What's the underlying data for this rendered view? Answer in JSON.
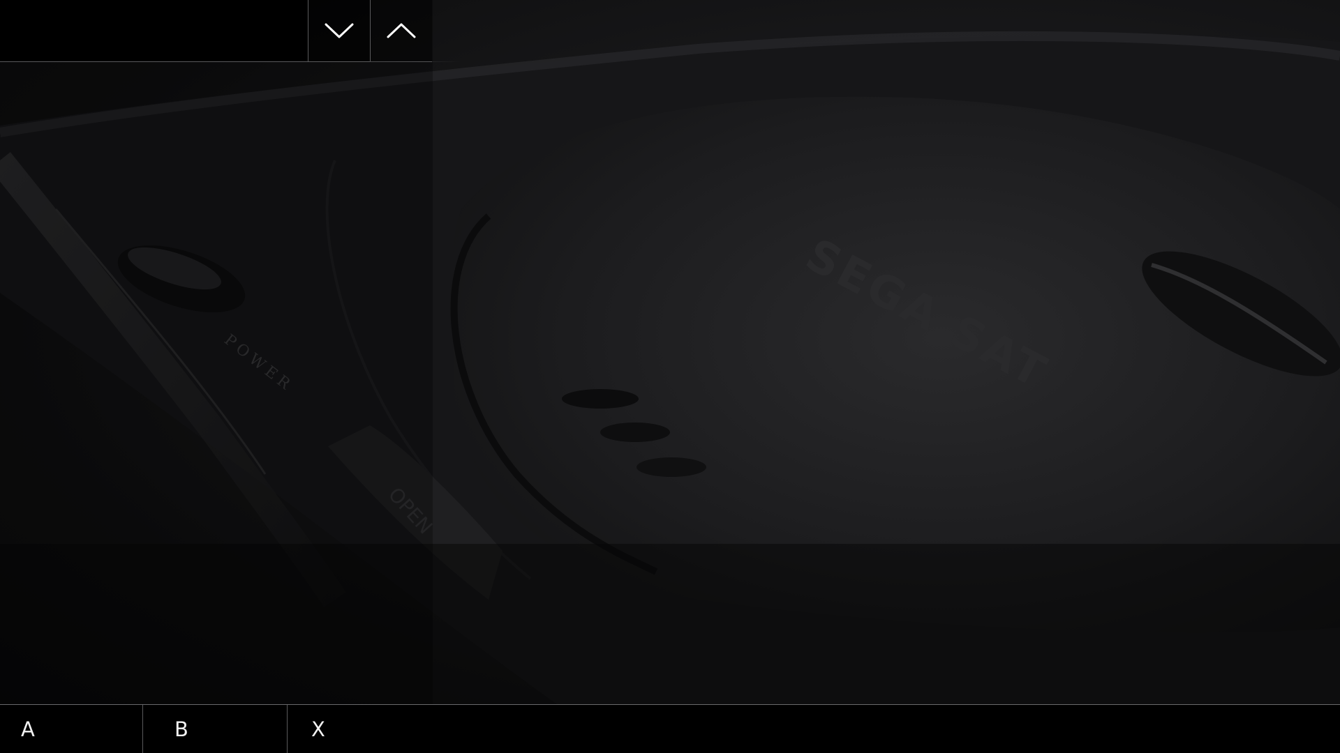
{
  "top_bar": {
    "title": "",
    "down_icon": "chevron-down-icon",
    "up_icon": "chevron-up-icon"
  },
  "bottom_bar": {
    "buttons": [
      {
        "label": "A"
      },
      {
        "label": "B"
      },
      {
        "label": "X"
      }
    ]
  },
  "theme": {
    "background": "#0a0a0b",
    "bar_background": "#000000",
    "divider": "#5a5a5c",
    "text": "#f2f2f2"
  }
}
